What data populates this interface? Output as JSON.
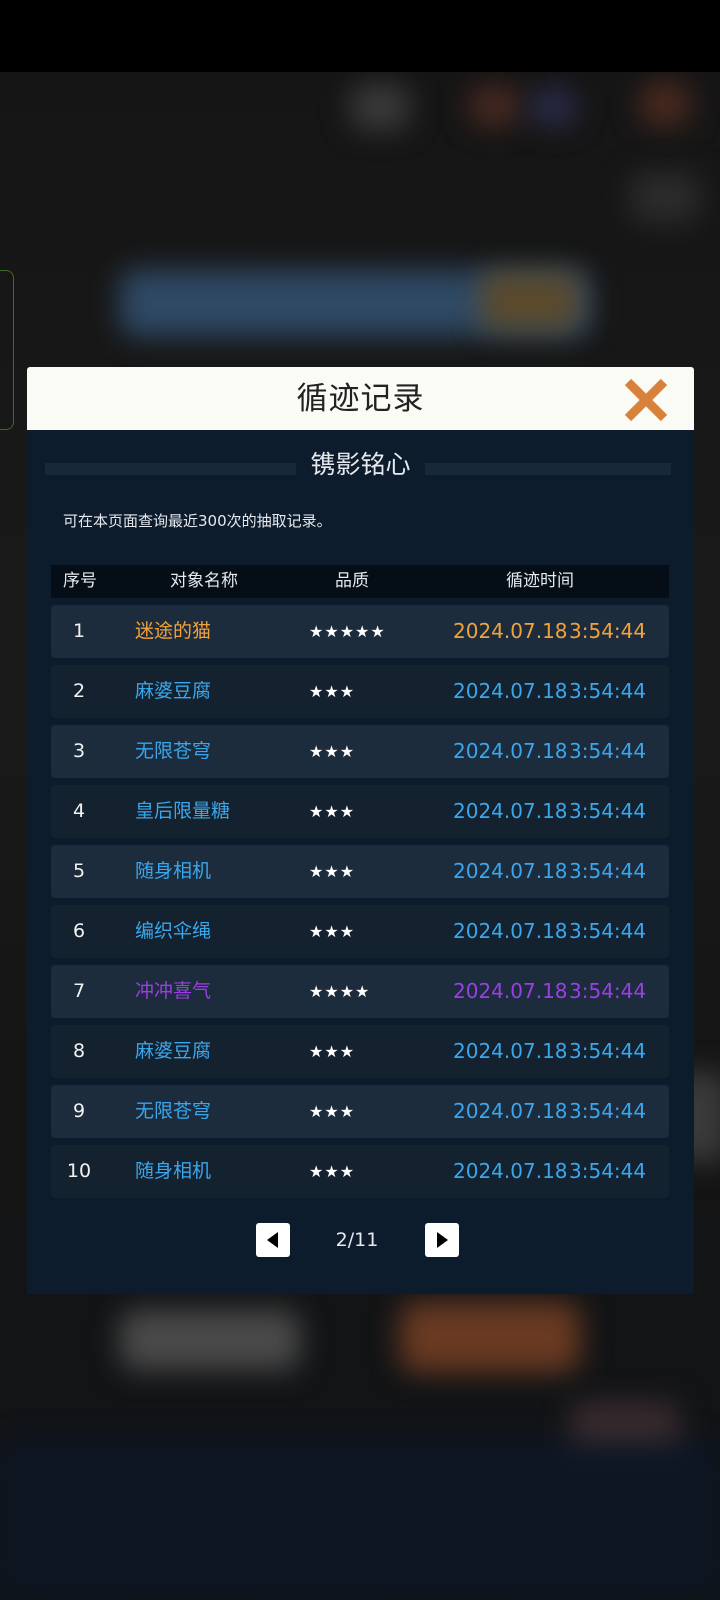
{
  "dialog": {
    "title": "循迹记录",
    "subtitle": "镌影铭心",
    "notice": "可在本页面查询最近300次的抽取记录。"
  },
  "table": {
    "headers": [
      "序号",
      "对象名称",
      "品质",
      "循迹时间"
    ],
    "rows": [
      {
        "index": "1",
        "name": "迷途的猫",
        "stars": "★★★★★",
        "date": "2024.07.18",
        "time": "3:54:44",
        "color": "#f2a23a"
      },
      {
        "index": "2",
        "name": "麻婆豆腐",
        "stars": "★★★",
        "date": "2024.07.18",
        "time": "3:54:44",
        "color": "#3aa6ec"
      },
      {
        "index": "3",
        "name": "无限苍穹",
        "stars": "★★★",
        "date": "2024.07.18",
        "time": "3:54:44",
        "color": "#3aa6ec"
      },
      {
        "index": "4",
        "name": "皇后限量糖",
        "stars": "★★★",
        "date": "2024.07.18",
        "time": "3:54:44",
        "color": "#3aa6ec"
      },
      {
        "index": "5",
        "name": "随身相机",
        "stars": "★★★",
        "date": "2024.07.18",
        "time": "3:54:44",
        "color": "#3aa6ec"
      },
      {
        "index": "6",
        "name": "编织伞绳",
        "stars": "★★★",
        "date": "2024.07.18",
        "time": "3:54:44",
        "color": "#3aa6ec"
      },
      {
        "index": "7",
        "name": "冲冲喜气",
        "stars": "★★★★",
        "date": "2024.07.18",
        "time": "3:54:44",
        "color": "#9b3fe3"
      },
      {
        "index": "8",
        "name": "麻婆豆腐",
        "stars": "★★★",
        "date": "2024.07.18",
        "time": "3:54:44",
        "color": "#3aa6ec"
      },
      {
        "index": "9",
        "name": "无限苍穹",
        "stars": "★★★",
        "date": "2024.07.18",
        "time": "3:54:44",
        "color": "#3aa6ec"
      },
      {
        "index": "10",
        "name": "随身相机",
        "stars": "★★★",
        "date": "2024.07.18",
        "time": "3:54:44",
        "color": "#3aa6ec"
      }
    ]
  },
  "pagination": {
    "label": "2/11",
    "prev_icon": "triangle-left-icon",
    "next_icon": "triangle-right-icon"
  },
  "icons": {
    "close": "close-x-icon"
  },
  "colors": {
    "gold": "#f2a23a",
    "blue": "#3aa6ec",
    "purple": "#9b3fe3",
    "close_accent": "#d8813a"
  }
}
